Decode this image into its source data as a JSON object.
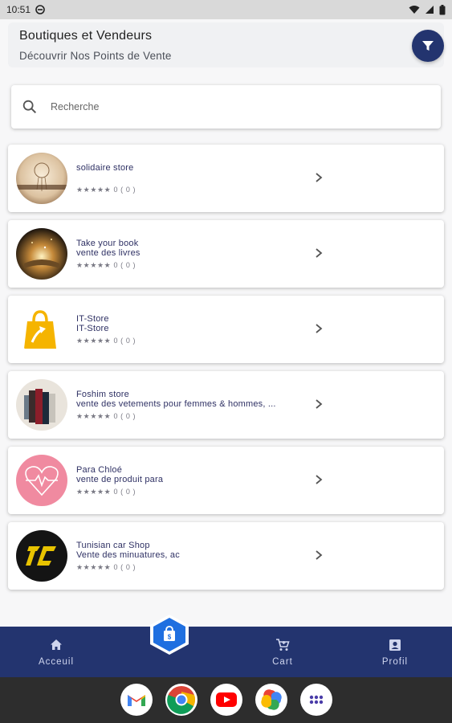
{
  "status_bar": {
    "time": "10:51"
  },
  "header": {
    "title": "Boutiques et Vendeurs",
    "subtitle": "Découvrir Nos Points de Vente",
    "filter_icon": "filter-icon"
  },
  "search": {
    "placeholder": "Recherche",
    "value": ""
  },
  "stores": [
    {
      "name": "solidaire store",
      "description": "",
      "rating_text": "★★★★★ 0 ( 0 )",
      "rating": 0,
      "reviews": 0
    },
    {
      "name": "Take your book",
      "description": "vente des livres",
      "rating_text": "★★★★★ 0 ( 0 )",
      "rating": 0,
      "reviews": 0
    },
    {
      "name": "IT-Store",
      "description": "IT-Store",
      "rating_text": "★★★★★ 0 ( 0 )",
      "rating": 0,
      "reviews": 0
    },
    {
      "name": "Foshim store",
      "description": "vente des vetements pour femmes & hommes, ...",
      "rating_text": "★★★★★ 0 ( 0 )",
      "rating": 0,
      "reviews": 0
    },
    {
      "name": "Para Chloé",
      "description": "vente de produit para",
      "rating_text": "★★★★★ 0 ( 0 )",
      "rating": 0,
      "reviews": 0
    },
    {
      "name": "Tunisian car Shop",
      "description": "Vente des minuatures, ac",
      "rating_text": "★★★★★ 0 ( 0 )",
      "rating": 0,
      "reviews": 0
    }
  ],
  "bottom_nav": {
    "home_label": "Acceuil",
    "cart_label": "Cart",
    "profile_label": "Profil"
  },
  "colors": {
    "primary": "#23346f",
    "accent_gold": "#f5b400",
    "text_store": "#2f3164"
  },
  "system_apps": [
    "gmail-icon",
    "chrome-icon",
    "youtube-icon",
    "photos-icon",
    "app-drawer-icon"
  ]
}
